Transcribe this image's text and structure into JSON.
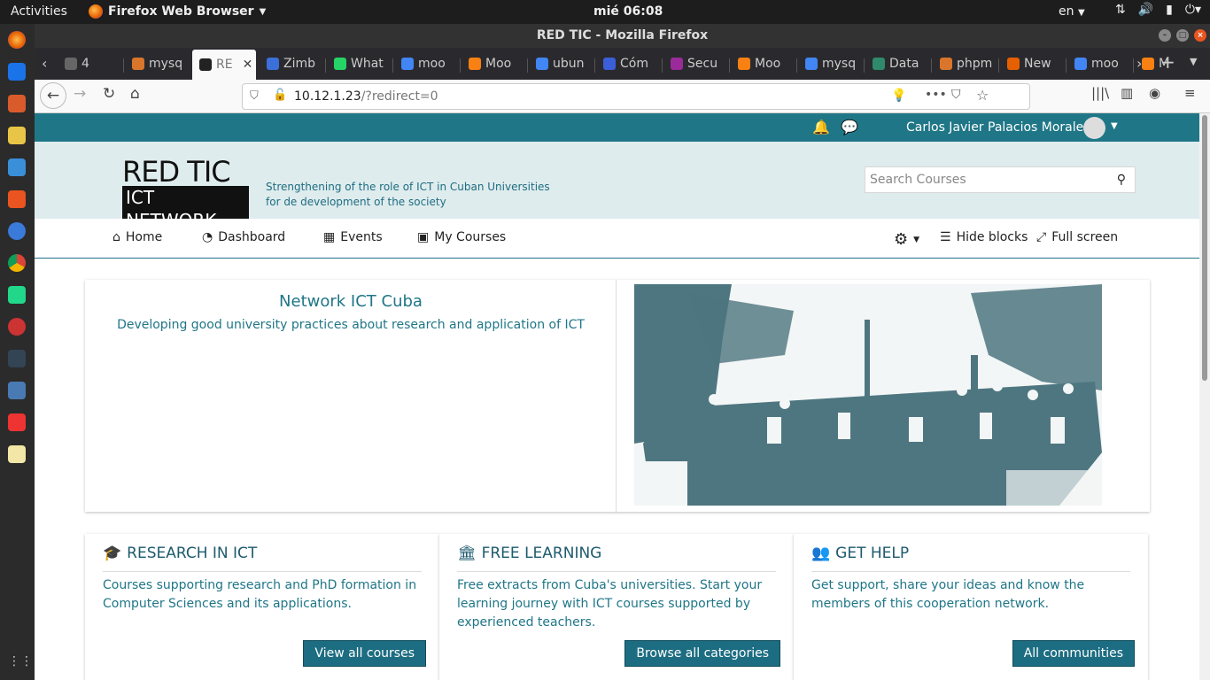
{
  "system": {
    "activities": "Activities",
    "app_name": "Firefox Web Browser",
    "clock": "mié 06:08",
    "lang": "en"
  },
  "window": {
    "title": "RED TIC - Mozilla Firefox"
  },
  "tabs": [
    {
      "label": "4",
      "color": "#666"
    },
    {
      "label": "mysq",
      "color": "#d9762b"
    },
    {
      "label": "RE",
      "color": "#222",
      "active": true
    },
    {
      "label": "Zimb",
      "color": "#3b6fd9"
    },
    {
      "label": "What",
      "color": "#25d366"
    },
    {
      "label": "moo",
      "color": "#4285f4"
    },
    {
      "label": "Moo",
      "color": "#f98012"
    },
    {
      "label": "ubun",
      "color": "#4285f4"
    },
    {
      "label": "Cóm",
      "color": "#3b5fd9"
    },
    {
      "label": "Secu",
      "color": "#9b2b9b"
    },
    {
      "label": "Moo",
      "color": "#f98012"
    },
    {
      "label": "mysq",
      "color": "#4285f4"
    },
    {
      "label": "Data",
      "color": "#2f8a6b"
    },
    {
      "label": "phpm",
      "color": "#d9762b"
    },
    {
      "label": "New",
      "color": "#e66000"
    },
    {
      "label": "moo",
      "color": "#4285f4"
    },
    {
      "label": "M",
      "color": "#f98012"
    }
  ],
  "url": {
    "host": "10.12.1.23",
    "path": "/?redirect=0"
  },
  "user": {
    "name": "Carlos Javier Palacios Morales"
  },
  "logo": {
    "line1": "RED TIC",
    "line2": "ICT NETWORK"
  },
  "slogan": {
    "line1": "Strengthening of the role of ICT in Cuban Universities",
    "line2": "for de development of the society"
  },
  "search": {
    "placeholder": "Search Courses"
  },
  "menu": {
    "home": "Home",
    "dashboard": "Dashboard",
    "events": "Events",
    "my_courses": "My Courses",
    "hide_blocks": "Hide blocks",
    "full_screen": "Full screen"
  },
  "hero": {
    "title": "Network ICT Cuba",
    "subtitle": "Developing good university practices about research and application of ICT"
  },
  "cards": [
    {
      "title": "RESEARCH IN ICT",
      "desc": "Courses supporting research and PhD formation in Computer Sciences and its applications.",
      "button": "View all courses"
    },
    {
      "title": "FREE LEARNING",
      "desc": "Free extracts from Cuba's universities. Start your learning journey with ICT courses supported by experienced teachers.",
      "button": "Browse all categories"
    },
    {
      "title": "GET HELP",
      "desc": "Get support, share your ideas and know the members of this cooperation network.",
      "button": "All communities"
    }
  ]
}
